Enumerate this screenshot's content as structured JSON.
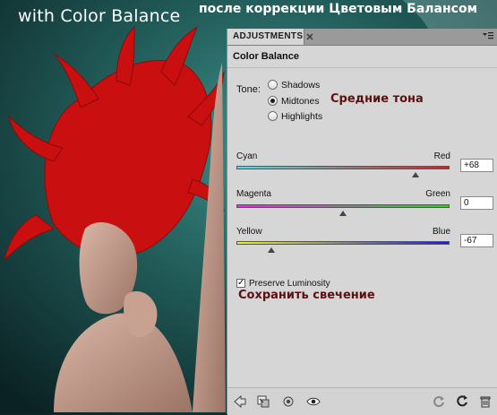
{
  "captions": {
    "english": "with Color Balance",
    "russian": "после коррекции Цветовым Балансом"
  },
  "panel": {
    "tab_label": "ADJUSTMENTS",
    "title": "Color Balance",
    "tone_label": "Tone:",
    "tones": [
      {
        "label": "Shadows",
        "selected": false
      },
      {
        "label": "Midtones",
        "selected": true
      },
      {
        "label": "Highlights",
        "selected": false
      }
    ],
    "tone_annotation": "Средние тона",
    "sliders": [
      {
        "left": "Cyan",
        "right": "Red",
        "value": "+68",
        "level": 68,
        "min": -100,
        "max": 100,
        "gradient": [
          "#3fe7f0",
          "#e81616"
        ]
      },
      {
        "left": "Magenta",
        "right": "Green",
        "value": "0",
        "level": 0,
        "min": -100,
        "max": 100,
        "gradient": [
          "#ee22ee",
          "#20d820"
        ]
      },
      {
        "left": "Yellow",
        "right": "Blue",
        "value": "-67",
        "level": -67,
        "min": -100,
        "max": 100,
        "gradient": [
          "#f0f020",
          "#1a1ae8"
        ]
      }
    ],
    "preserve_luminosity": {
      "label": "Preserve Luminosity",
      "checked": true
    },
    "preserve_annotation": "Сохранить свечение",
    "bottom_icons": [
      "back-arrow-icon",
      "clip-to-layer-icon",
      "visibility-toggle-icon",
      "eye-icon",
      "reset-icon",
      "refresh-icon",
      "trash-icon"
    ]
  }
}
